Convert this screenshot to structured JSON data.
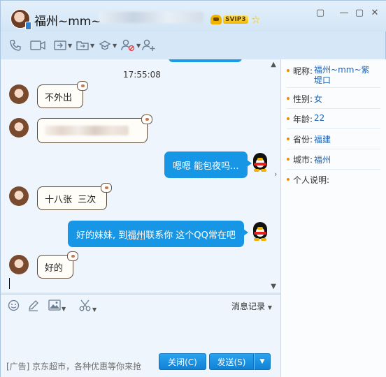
{
  "title": {
    "name": "福州~mm~",
    "vip_label": "SVIP3"
  },
  "chat": {
    "time": "17:55:08",
    "messages": [
      {
        "side": "in",
        "text": "不外出"
      },
      {
        "side": "in",
        "text": ""
      },
      {
        "side": "out",
        "text": "嗯嗯 能包夜吗..."
      },
      {
        "side": "in",
        "text": "十八张  三次"
      },
      {
        "side": "out",
        "text_before": "好的妹妹, 到",
        "link": "福州",
        "text_after": "联系你 这个QQ常在吧"
      },
      {
        "side": "in",
        "text": "好的"
      }
    ]
  },
  "input_tools": {
    "history_label": "消息记录"
  },
  "bottom": {
    "ad": "[广告] 京东超市，各种优惠等你来抢",
    "close_label": "关闭(C)",
    "send_label": "发送(S)"
  },
  "profile": {
    "rows": [
      {
        "key": "昵称:",
        "value": "福州~mm~紫堤口"
      },
      {
        "key": "性别:",
        "value": "女"
      },
      {
        "key": "年龄:",
        "value": "22"
      },
      {
        "key": "省份:",
        "value": "福建"
      },
      {
        "key": "城市:",
        "value": "福州"
      },
      {
        "key": "个人说明:",
        "value": ""
      }
    ]
  }
}
